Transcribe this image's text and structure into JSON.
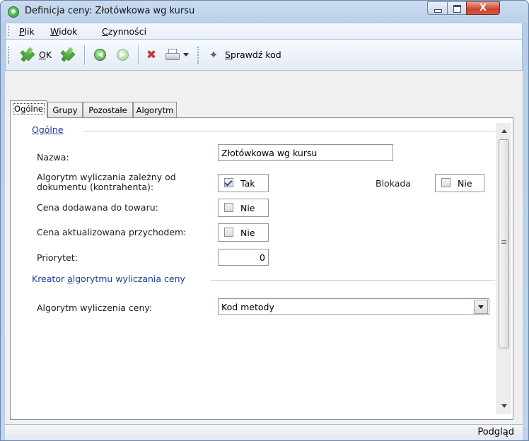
{
  "window": {
    "title": "Definicja ceny: Złotówkowa wg kursu",
    "close_glyph": "X"
  },
  "menu": {
    "items": [
      {
        "label_first": "P",
        "label_rest": "lik"
      },
      {
        "label_first": "W",
        "label_rest": "idok"
      },
      {
        "label_first": "C",
        "label_rest": "zynności"
      }
    ]
  },
  "toolbar": {
    "ok_first": "O",
    "ok_rest": "K",
    "check_code_first": "S",
    "check_code_rest": "prawdź kod",
    "icons": [
      "ok-check-icon",
      "ok-close-check-icon",
      "back-icon",
      "forward-icon",
      "tools-icon",
      "print-icon",
      "dropdown-arrow-icon",
      "wand-icon"
    ]
  },
  "tabs": [
    {
      "label": "Ogólne",
      "active": true
    },
    {
      "label": "Grupy",
      "active": false
    },
    {
      "label": "Pozostałe",
      "active": false
    },
    {
      "label": "Algorytm",
      "active": false
    }
  ],
  "general": {
    "group_title": "Ogólne",
    "name_label": "Nazwa:",
    "name_value": "Złotówkowa wg kursu",
    "algo_label_line1": "Algorytm wyliczania zależny od",
    "algo_label_line2": "dokumentu (kontrahenta):",
    "algo_value": "Tak",
    "algo_checked": true,
    "block_label": "Blokada",
    "block_value": "Nie",
    "added_label": "Cena dodawana do towaru:",
    "added_value": "Nie",
    "updated_label": "Cena aktualizowana przychodem:",
    "updated_value": "Nie",
    "priority_label": "Priorytet:",
    "priority_value": "0"
  },
  "creator": {
    "group_title_before": "Kreator ",
    "group_title_underlined": "a",
    "group_title_after": "lgorytmu wyliczania ceny",
    "algo_label": "Algorytm wyliczenia ceny:",
    "algo_value": "Kod metody"
  },
  "status": {
    "text": "Podgląd"
  },
  "colors": {
    "group_title": "#1a3e9c",
    "check_green": "#4ea33c",
    "close_red": "#c9452b"
  }
}
